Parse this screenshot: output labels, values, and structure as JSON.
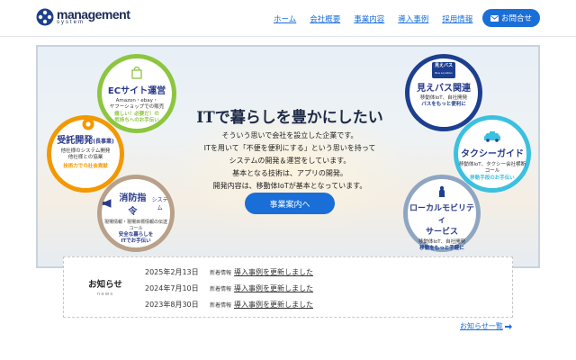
{
  "header": {
    "logo_main": "management",
    "logo_sub": "system",
    "nav": [
      "ホーム",
      "会社概要",
      "事業内容",
      "導入事例",
      "採用情報"
    ],
    "contact_label": "お問合せ"
  },
  "hero": {
    "title": "ITで暮らしを豊かにしたい",
    "lines": [
      "そういう思いで会社を設立した企業です。",
      "ITを用いて「不便を便利にする」という思いを持って",
      "システムの開発＆運営をしています。",
      "基本となる技術は、アプリの開発。",
      "開発内容は、移動体IoTが基本となっています。"
    ],
    "button_label": "事業案内へ",
    "circles": {
      "ec": {
        "title": "ECサイト運営",
        "desc": [
          "Amazon・ebay・",
          "ヤフーショップでの販売"
        ],
        "em": [
          "嬉しい！必要だ！の",
          "気持ちへのお手伝い"
        ]
      },
      "contract": {
        "title": "受託開発",
        "tag": "(長事業)",
        "desc": [
          "他社様のシステム開発",
          "他社様との協業"
        ],
        "em": [
          "技術力での社会貢献"
        ]
      },
      "fire": {
        "title": "消防指令",
        "title_suffix": "システム",
        "desc": [
          "現場情報・現場目標情報の伝送",
          "コール"
        ],
        "em": [
          "安全な暮らしを",
          "ITでお手伝い"
        ]
      },
      "bus": {
        "title": "見えバス関連",
        "badge": "見えバス",
        "badge_sub": "Bus Location",
        "desc": [
          "移動体IoT、自社開発"
        ],
        "em": [
          "バスをもっと便利に"
        ]
      },
      "taxi": {
        "title": "タクシーガイド",
        "desc": [
          "移動体IoT、タクシー会社横断",
          "コール"
        ],
        "em": [
          "移動手段のお手伝い"
        ]
      },
      "mobility": {
        "title": "ローカルモビリティ",
        "title2": "サービス",
        "desc": [
          "移動体IoT、自社開発"
        ],
        "em": [
          "移動をもっと手軽に"
        ]
      }
    }
  },
  "news": {
    "title": "お知らせ",
    "sub": "news",
    "items": [
      {
        "date": "2025年2月13日",
        "category": "新着情報",
        "text": "導入事例を更新しました"
      },
      {
        "date": "2024年7月10日",
        "category": "新着情報",
        "text": "導入事例を更新しました"
      },
      {
        "date": "2023年8月30日",
        "category": "新着情報",
        "text": "導入事例を更新しました"
      }
    ],
    "more_label": "お知らせ一覧"
  },
  "colors": {
    "accent": "#1a6ed8",
    "ec": "#8cc63f",
    "contract": "#f39800",
    "fire": "#b8a08a",
    "bus": "#1d3f8f",
    "taxi": "#3cc0e0",
    "mobility": "#8fa6c3"
  },
  "icons": [
    "logo-mark-icon",
    "mail-icon",
    "shopping-bag-icon",
    "gear-icon",
    "megaphone-icon",
    "bus-badge-icon",
    "taxi-icon",
    "person-icon",
    "arrow-right-icon"
  ]
}
